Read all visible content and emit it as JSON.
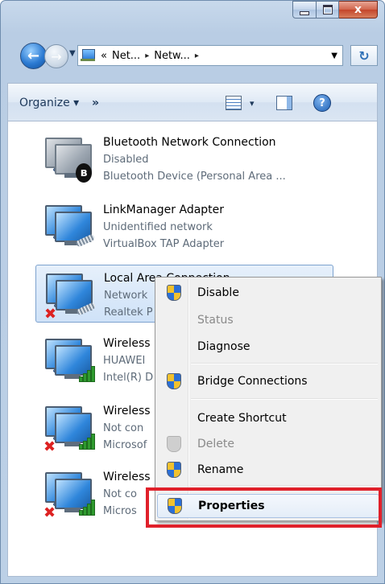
{
  "window": {
    "caption": {
      "minimize": "",
      "maximize": "",
      "close": "x"
    }
  },
  "nav": {
    "back_icon": "back-arrow-icon",
    "forward_icon": "forward-arrow-icon",
    "address": {
      "prefix": "«",
      "crumbs": [
        "Net...",
        "Netw..."
      ],
      "separator": "▸"
    },
    "refresh_icon": "refresh-icon"
  },
  "toolbar": {
    "organize": "Organize ▾",
    "more": "»",
    "view_icon": "change-view-icon",
    "view_drop": "▾",
    "pane_icon": "preview-pane-icon",
    "help": "?"
  },
  "connections": [
    {
      "name": "Bluetooth Network Connection",
      "status": "Disabled",
      "device": "Bluetooth Device (Personal Area ...",
      "icon": "bluetooth-network-icon"
    },
    {
      "name": "LinkManager Adapter",
      "status": "Unidentified network",
      "device": "VirtualBox TAP Adapter",
      "icon": "wired-network-icon"
    },
    {
      "name": "Local Area Connection",
      "status": "Network",
      "device": "Realtek P",
      "icon": "wired-network-disconnected-icon",
      "selected": true
    },
    {
      "name": "Wireless",
      "status": "HUAWEI",
      "device": "Intel(R) D",
      "icon": "wireless-network-icon"
    },
    {
      "name": "Wireless",
      "status": "Not con",
      "device": "Microsof",
      "icon": "wireless-network-disconnected-icon"
    },
    {
      "name": "Wireless",
      "status": "Not co",
      "device": "Micros",
      "icon": "wireless-network-disconnected-icon"
    }
  ],
  "context_menu": {
    "items": [
      {
        "label": "Disable",
        "shield": true,
        "disabled": false,
        "bold": false
      },
      {
        "label": "Status",
        "shield": false,
        "disabled": true,
        "bold": false
      },
      {
        "label": "Diagnose",
        "shield": false,
        "disabled": false,
        "bold": false
      },
      {
        "label": "Bridge Connections",
        "shield": true,
        "disabled": false,
        "bold": false
      },
      {
        "label": "Create Shortcut",
        "shield": false,
        "disabled": false,
        "bold": false
      },
      {
        "label": "Delete",
        "shield": true,
        "disabled": true,
        "bold": false
      },
      {
        "label": "Rename",
        "shield": true,
        "disabled": false,
        "bold": false
      },
      {
        "label": "Properties",
        "shield": true,
        "disabled": false,
        "bold": true,
        "hovered": true
      }
    ]
  },
  "colors": {
    "highlight_box": "#e0202a",
    "selection_bg": "#cfe2f8",
    "disabled_text": "#8a8a8a"
  }
}
